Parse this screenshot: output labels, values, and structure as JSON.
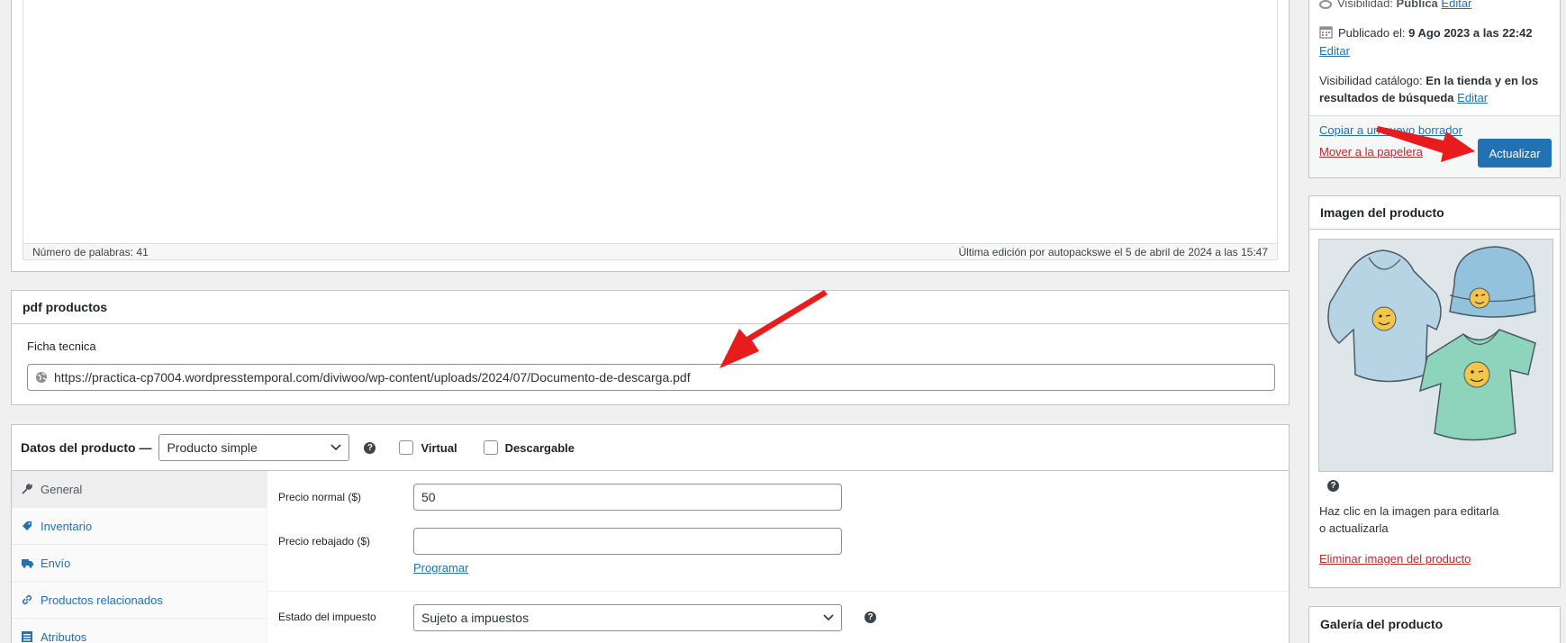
{
  "editor": {
    "word_count": "Número de palabras: 41",
    "last_edit": "Última edición por autopackswe el 5 de abril de 2024 a las 15:47"
  },
  "pdf_box": {
    "title": "pdf productos",
    "field_label": "Ficha tecnica",
    "field_value": "https://practica-cp7004.wordpresstemporal.com/diviwoo/wp-content/uploads/2024/07/Documento-de-descarga.pdf"
  },
  "product_data": {
    "title": "Datos del producto —",
    "type_selected": "Producto simple",
    "virtual_label": "Virtual",
    "downloadable_label": "Descargable",
    "tabs": [
      {
        "label": "General",
        "icon": "wrench-icon"
      },
      {
        "label": "Inventario",
        "icon": "tag-icon"
      },
      {
        "label": "Envío",
        "icon": "truck-icon"
      },
      {
        "label": "Productos relacionados",
        "icon": "link-icon"
      },
      {
        "label": "Atributos",
        "icon": "list-icon"
      }
    ],
    "regular_price_label": "Precio normal ($)",
    "regular_price_value": "50",
    "sale_price_label": "Precio rebajado ($)",
    "sale_price_value": "",
    "schedule_link": "Programar",
    "tax_status_label": "Estado del impuesto",
    "tax_status_value": "Sujeto a impuestos"
  },
  "publish": {
    "visibility_label": "Visibilidad:",
    "visibility_value": "Pública",
    "visibility_edit": "Editar",
    "published_label": "Publicado el:",
    "published_value": "9 Ago 2023 a las 22:42",
    "published_edit": "Editar",
    "catalog_label": "Visibilidad catálogo:",
    "catalog_value": "En la tienda y en los resultados de búsqueda",
    "catalog_edit": "Editar",
    "copy_draft": "Copiar a un nuevo borrador",
    "move_trash": "Mover a la papelera",
    "update_button": "Actualizar"
  },
  "product_image": {
    "title": "Imagen del producto",
    "hint": "Haz clic en la imagen para editarla o actualizarla",
    "remove_link": "Eliminar imagen del producto"
  },
  "gallery": {
    "title": "Galería del producto"
  },
  "colors": {
    "primary": "#2271b1",
    "danger": "#b32d2e",
    "annotation_arrow": "#e81c1c"
  }
}
